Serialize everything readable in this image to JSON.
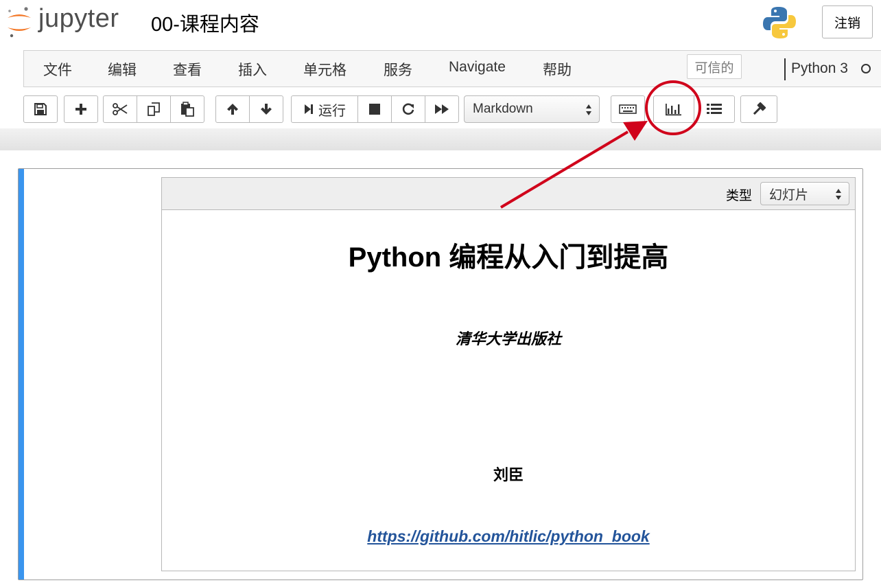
{
  "header": {
    "logo_text": "jupyter",
    "notebook_title": "00-课程内容",
    "logout_label": "注销"
  },
  "menubar": {
    "items": [
      "文件",
      "编辑",
      "查看",
      "插入",
      "单元格",
      "服务",
      "Navigate",
      "帮助"
    ],
    "trusted_label": "可信的",
    "kernel_name": "Python 3"
  },
  "toolbar": {
    "run_label": "运行",
    "cell_type": "Markdown"
  },
  "cell": {
    "toolbar_label": "类型",
    "slide_type": "幻灯片",
    "heading": "Python 编程从入门到提高",
    "publisher": "清华大学出版社",
    "author": "刘臣",
    "link": "https://github.com/hitlic/python_book"
  },
  "annotation": {
    "color": "#d0021b",
    "target": "presentation-toolbar-button"
  },
  "colors": {
    "cell_accent": "#3a95ee",
    "link": "#23549a",
    "logo_orange": "#f37726"
  }
}
